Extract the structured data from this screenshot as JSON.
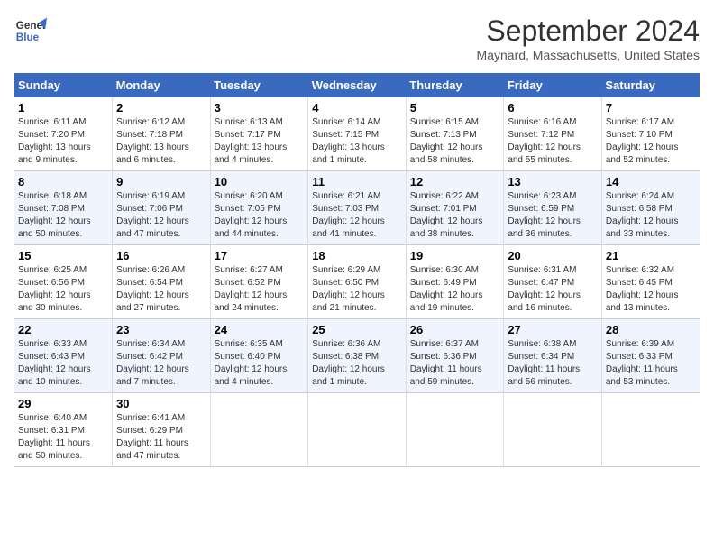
{
  "logo": {
    "line1": "General",
    "line2": "Blue"
  },
  "title": "September 2024",
  "location": "Maynard, Massachusetts, United States",
  "days_of_week": [
    "Sunday",
    "Monday",
    "Tuesday",
    "Wednesday",
    "Thursday",
    "Friday",
    "Saturday"
  ],
  "weeks": [
    [
      {
        "day": "1",
        "info": "Sunrise: 6:11 AM\nSunset: 7:20 PM\nDaylight: 13 hours\nand 9 minutes."
      },
      {
        "day": "2",
        "info": "Sunrise: 6:12 AM\nSunset: 7:18 PM\nDaylight: 13 hours\nand 6 minutes."
      },
      {
        "day": "3",
        "info": "Sunrise: 6:13 AM\nSunset: 7:17 PM\nDaylight: 13 hours\nand 4 minutes."
      },
      {
        "day": "4",
        "info": "Sunrise: 6:14 AM\nSunset: 7:15 PM\nDaylight: 13 hours\nand 1 minute."
      },
      {
        "day": "5",
        "info": "Sunrise: 6:15 AM\nSunset: 7:13 PM\nDaylight: 12 hours\nand 58 minutes."
      },
      {
        "day": "6",
        "info": "Sunrise: 6:16 AM\nSunset: 7:12 PM\nDaylight: 12 hours\nand 55 minutes."
      },
      {
        "day": "7",
        "info": "Sunrise: 6:17 AM\nSunset: 7:10 PM\nDaylight: 12 hours\nand 52 minutes."
      }
    ],
    [
      {
        "day": "8",
        "info": "Sunrise: 6:18 AM\nSunset: 7:08 PM\nDaylight: 12 hours\nand 50 minutes."
      },
      {
        "day": "9",
        "info": "Sunrise: 6:19 AM\nSunset: 7:06 PM\nDaylight: 12 hours\nand 47 minutes."
      },
      {
        "day": "10",
        "info": "Sunrise: 6:20 AM\nSunset: 7:05 PM\nDaylight: 12 hours\nand 44 minutes."
      },
      {
        "day": "11",
        "info": "Sunrise: 6:21 AM\nSunset: 7:03 PM\nDaylight: 12 hours\nand 41 minutes."
      },
      {
        "day": "12",
        "info": "Sunrise: 6:22 AM\nSunset: 7:01 PM\nDaylight: 12 hours\nand 38 minutes."
      },
      {
        "day": "13",
        "info": "Sunrise: 6:23 AM\nSunset: 6:59 PM\nDaylight: 12 hours\nand 36 minutes."
      },
      {
        "day": "14",
        "info": "Sunrise: 6:24 AM\nSunset: 6:58 PM\nDaylight: 12 hours\nand 33 minutes."
      }
    ],
    [
      {
        "day": "15",
        "info": "Sunrise: 6:25 AM\nSunset: 6:56 PM\nDaylight: 12 hours\nand 30 minutes."
      },
      {
        "day": "16",
        "info": "Sunrise: 6:26 AM\nSunset: 6:54 PM\nDaylight: 12 hours\nand 27 minutes."
      },
      {
        "day": "17",
        "info": "Sunrise: 6:27 AM\nSunset: 6:52 PM\nDaylight: 12 hours\nand 24 minutes."
      },
      {
        "day": "18",
        "info": "Sunrise: 6:29 AM\nSunset: 6:50 PM\nDaylight: 12 hours\nand 21 minutes."
      },
      {
        "day": "19",
        "info": "Sunrise: 6:30 AM\nSunset: 6:49 PM\nDaylight: 12 hours\nand 19 minutes."
      },
      {
        "day": "20",
        "info": "Sunrise: 6:31 AM\nSunset: 6:47 PM\nDaylight: 12 hours\nand 16 minutes."
      },
      {
        "day": "21",
        "info": "Sunrise: 6:32 AM\nSunset: 6:45 PM\nDaylight: 12 hours\nand 13 minutes."
      }
    ],
    [
      {
        "day": "22",
        "info": "Sunrise: 6:33 AM\nSunset: 6:43 PM\nDaylight: 12 hours\nand 10 minutes."
      },
      {
        "day": "23",
        "info": "Sunrise: 6:34 AM\nSunset: 6:42 PM\nDaylight: 12 hours\nand 7 minutes."
      },
      {
        "day": "24",
        "info": "Sunrise: 6:35 AM\nSunset: 6:40 PM\nDaylight: 12 hours\nand 4 minutes."
      },
      {
        "day": "25",
        "info": "Sunrise: 6:36 AM\nSunset: 6:38 PM\nDaylight: 12 hours\nand 1 minute."
      },
      {
        "day": "26",
        "info": "Sunrise: 6:37 AM\nSunset: 6:36 PM\nDaylight: 11 hours\nand 59 minutes."
      },
      {
        "day": "27",
        "info": "Sunrise: 6:38 AM\nSunset: 6:34 PM\nDaylight: 11 hours\nand 56 minutes."
      },
      {
        "day": "28",
        "info": "Sunrise: 6:39 AM\nSunset: 6:33 PM\nDaylight: 11 hours\nand 53 minutes."
      }
    ],
    [
      {
        "day": "29",
        "info": "Sunrise: 6:40 AM\nSunset: 6:31 PM\nDaylight: 11 hours\nand 50 minutes."
      },
      {
        "day": "30",
        "info": "Sunrise: 6:41 AM\nSunset: 6:29 PM\nDaylight: 11 hours\nand 47 minutes."
      },
      {
        "day": "",
        "info": ""
      },
      {
        "day": "",
        "info": ""
      },
      {
        "day": "",
        "info": ""
      },
      {
        "day": "",
        "info": ""
      },
      {
        "day": "",
        "info": ""
      }
    ]
  ]
}
